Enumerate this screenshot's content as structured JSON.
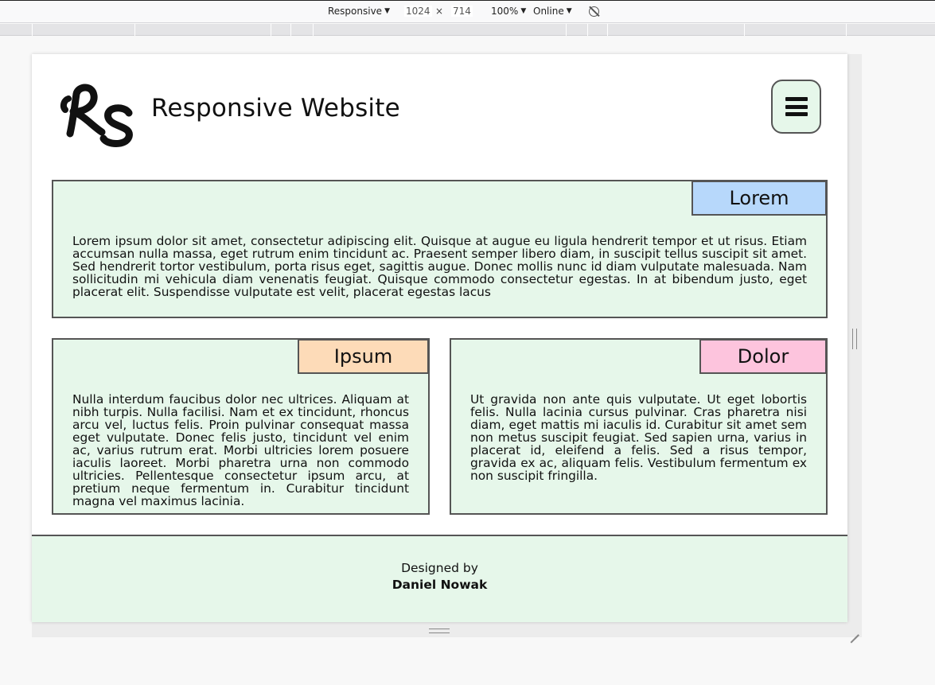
{
  "devtools": {
    "device_label": "Responsive",
    "width_value": "1024",
    "times_sign": "×",
    "height_value": "714",
    "zoom_label": "100%",
    "network_label": "Online",
    "caret": "▼"
  },
  "site": {
    "title": "Responsive Website",
    "logo_text": "RS",
    "accent_color": "#e6f7ea"
  },
  "cards": [
    {
      "tag": "Lorem",
      "tag_color": "#b7d8fb",
      "text": "Lorem ipsum dolor sit amet, consectetur adipiscing elit. Quisque at augue eu ligula hendrerit tempor et ut risus. Etiam accumsan nulla massa, eget rutrum enim tincidunt ac. Praesent semper libero diam, in suscipit tellus suscipit sit amet. Sed hendrerit tortor vestibulum, porta risus eget, sagittis augue. Donec mollis nunc id diam vulputate malesuada. Nam sollicitudin mi vehicula diam venenatis feugiat. Quisque commodo consectetur egestas. In at bibendum justo, eget placerat elit. Suspendisse vulputate est velit, placerat egestas lacus"
    },
    {
      "tag": "Ipsum",
      "tag_color": "#fddbb8",
      "text": "Nulla interdum faucibus dolor nec ultrices. Aliquam at nibh turpis. Nulla facilisi. Nam et ex tincidunt, rhoncus arcu vel, luctus felis. Proin pulvinar consequat massa eget vulputate. Donec felis justo, tincidunt vel enim ac, varius rutrum erat. Morbi ultricies lorem posuere iaculis laoreet. Morbi pharetra urna non commodo ultricies. Pellentesque consectetur ipsum arcu, at pretium neque fermentum in. Curabitur tincidunt magna vel maximus lacinia."
    },
    {
      "tag": "Dolor",
      "tag_color": "#fdc4dd",
      "text": "Ut gravida non ante quis vulputate. Ut eget lobortis felis. Nulla lacinia cursus pulvinar. Cras pharetra nisi diam, eget mattis mi iaculis id. Curabitur sit amet sem non metus suscipit feugiat. Sed sapien urna, varius in placerat id, eleifend a felis. Sed a risus tempor, gravida ex ac, aliquam felis. Vestibulum fermentum ex non suscipit fringilla."
    }
  ],
  "footer": {
    "designed_by": "Designed by",
    "author": "Daniel Nowak"
  },
  "icons": [
    "menu-hamburger-icon",
    "rotate-viewport-icon",
    "resize-handle-icon"
  ]
}
